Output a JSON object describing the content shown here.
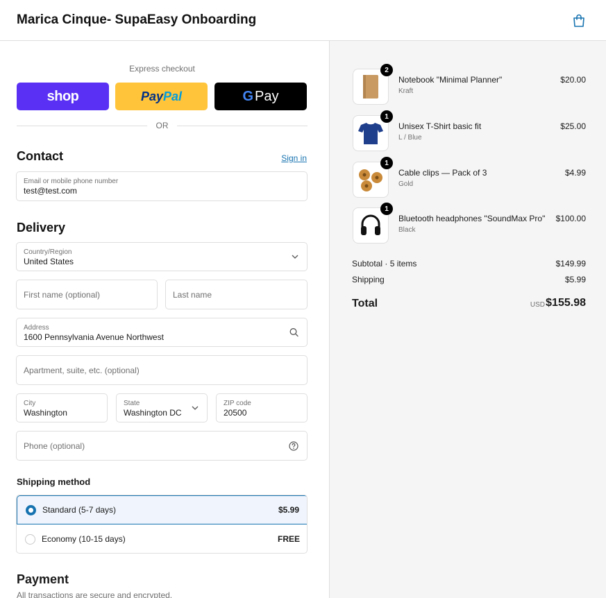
{
  "header": {
    "title": "Marica Cinque- SupaEasy Onboarding",
    "cart_icon": "shopping-bag-icon"
  },
  "express": {
    "label": "Express checkout",
    "shop_label": "shop",
    "paypal_label_1": "Pay",
    "paypal_label_2": "Pal",
    "gpay_g": "G",
    "gpay_label": "Pay",
    "or_label": "OR"
  },
  "contact": {
    "title": "Contact",
    "signin_label": "Sign in",
    "email_label": "Email or mobile phone number",
    "email_value": "test@test.com"
  },
  "delivery": {
    "title": "Delivery",
    "country_label": "Country/Region",
    "country_value": "United States",
    "first_name_placeholder": "First name (optional)",
    "last_name_placeholder": "Last name",
    "address_label": "Address",
    "address_value": "1600 Pennsylvania Avenue Northwest",
    "apartment_placeholder": "Apartment, suite, etc. (optional)",
    "city_label": "City",
    "city_value": "Washington",
    "state_label": "State",
    "state_value": "Washington DC",
    "zip_label": "ZIP code",
    "zip_value": "20500",
    "phone_placeholder": "Phone (optional)"
  },
  "shipping": {
    "title": "Shipping method",
    "options": [
      {
        "name": "Standard (5-7 days)",
        "price": "$5.99",
        "selected": true
      },
      {
        "name": "Economy (10-15 days)",
        "price": "FREE",
        "selected": false
      }
    ]
  },
  "payment": {
    "title": "Payment",
    "subtitle": "All transactions are secure and encrypted."
  },
  "order": {
    "items": [
      {
        "name": "Notebook \"Minimal Planner\"",
        "variant": "Kraft",
        "price": "$20.00",
        "qty": "2",
        "icon": "notebook-icon"
      },
      {
        "name": "Unisex T-Shirt basic fit",
        "variant": "L / Blue",
        "price": "$25.00",
        "qty": "1",
        "icon": "tshirt-icon"
      },
      {
        "name": "Cable clips — Pack of 3",
        "variant": "Gold",
        "price": "$4.99",
        "qty": "1",
        "icon": "cable-clips-icon"
      },
      {
        "name": "Bluetooth headphones \"SoundMax Pro\"",
        "variant": "Black",
        "price": "$100.00",
        "qty": "1",
        "icon": "headphones-icon"
      }
    ],
    "subtotal_label": "Subtotal · 5 items",
    "subtotal_value": "$149.99",
    "shipping_label": "Shipping",
    "shipping_value": "$5.99",
    "total_label": "Total",
    "currency": "USD",
    "total_value": "$155.98"
  },
  "colors": {
    "accent": "#1773b0",
    "shop": "#5a31f4",
    "paypal": "#ffc439",
    "gpay": "#000000"
  }
}
